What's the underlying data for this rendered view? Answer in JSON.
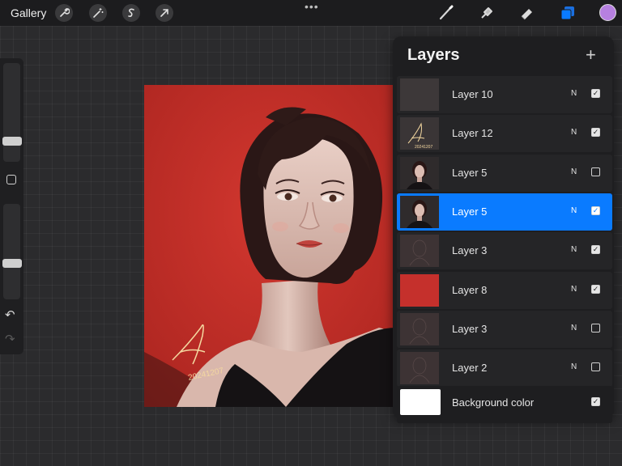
{
  "topbar": {
    "gallery_label": "Gallery",
    "left_tools": [
      "wrench-icon",
      "magic-wand-icon",
      "selection-s-icon",
      "transform-arrow-icon"
    ],
    "more_label": "•••",
    "right_tools": [
      "brush-icon",
      "smudge-icon",
      "eraser-icon",
      "layers-icon"
    ],
    "active_color": "#b680e0"
  },
  "sidebar": {
    "brush_size_level": 0.55,
    "opacity_level": 0.6,
    "undo_label": "↶",
    "redo_label": "↷"
  },
  "canvas": {
    "background_color": "#c5302c",
    "signature_text": "20241207"
  },
  "layers_panel": {
    "title": "Layers",
    "add_label": "+",
    "layers": [
      {
        "name": "Layer 10",
        "blend": "N",
        "visible": true,
        "selected": false,
        "thumb": "blank"
      },
      {
        "name": "Layer 12",
        "blend": "N",
        "visible": true,
        "selected": false,
        "thumb": "signature"
      },
      {
        "name": "Layer 5",
        "blend": "N",
        "visible": false,
        "selected": false,
        "thumb": "portrait"
      },
      {
        "name": "Layer 5",
        "blend": "N",
        "visible": true,
        "selected": true,
        "thumb": "portrait"
      },
      {
        "name": "Layer 3",
        "blend": "N",
        "visible": true,
        "selected": false,
        "thumb": "sketch"
      },
      {
        "name": "Layer 8",
        "blend": "N",
        "visible": true,
        "selected": false,
        "thumb": "red"
      },
      {
        "name": "Layer 3",
        "blend": "N",
        "visible": false,
        "selected": false,
        "thumb": "sketch"
      },
      {
        "name": "Layer 2",
        "blend": "N",
        "visible": false,
        "selected": false,
        "thumb": "sketch"
      }
    ],
    "background": {
      "name": "Background color",
      "visible": true,
      "color": "#ffffff"
    }
  }
}
